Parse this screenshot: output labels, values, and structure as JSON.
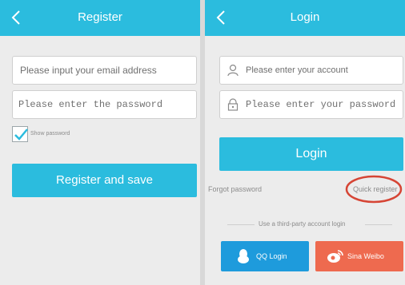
{
  "register": {
    "title": "Register",
    "email_placeholder": "Please input your email address",
    "password_placeholder": "Please enter the password",
    "show_password_label": "Show password",
    "show_password_checked": true,
    "register_button_label": "Register and save"
  },
  "login": {
    "title": "Login",
    "account_placeholder": "Please enter your account",
    "password_placeholder": "Please enter your password",
    "login_button_label": "Login",
    "forgot_password_label": "Forgot password",
    "quick_register_label": "Quick register",
    "third_party_label": "Use a third-party account login",
    "qq_label": "QQ Login",
    "weibo_label": "Sina Weibo"
  },
  "colors": {
    "primary": "#2bbcde",
    "qq_blue": "#1e9bdc",
    "weibo_red": "#ee6a4f",
    "highlight_circle": "#d64535"
  },
  "icons": {
    "back": "chevron-left-icon",
    "user": "user-icon",
    "lock": "lock-icon",
    "qq": "qq-penguin-icon",
    "weibo": "weibo-icon"
  }
}
